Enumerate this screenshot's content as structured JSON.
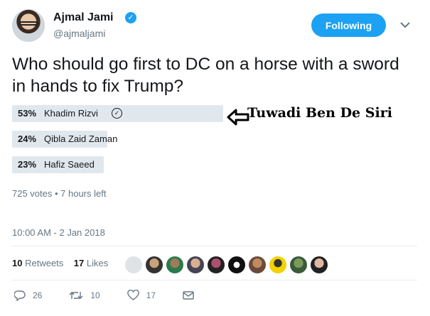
{
  "header": {
    "name": "Ajmal Jami",
    "handle": "@ajmaljami",
    "follow_label": "Following"
  },
  "tweet": {
    "text": "Who should go first to DC on a horse with a sword in hands to fix Trump?"
  },
  "poll": {
    "options": [
      {
        "pct": "53%",
        "label": "Khadim Rizvi",
        "fraction": 0.53,
        "winner": true
      },
      {
        "pct": "24%",
        "label": "Qibla Zaid Zaman",
        "fraction": 0.24,
        "winner": false
      },
      {
        "pct": "23%",
        "label": "Hafiz Saeed",
        "fraction": 0.23,
        "winner": false
      }
    ],
    "meta": "725 votes • 7 hours left",
    "annotation": "Tuwadi Ben De Siri"
  },
  "timestamp": "10:00 AM - 2 Jan 2018",
  "stats": {
    "retweets_count": "10",
    "retweets_label": "Retweets",
    "likes_count": "17",
    "likes_label": "Likes"
  },
  "actions": {
    "reply_count": "26",
    "retweet_count": "10",
    "like_count": "17"
  },
  "colors": {
    "accent": "#1da1f2",
    "poll_bar": "#e1e8ed",
    "muted": "#657786"
  }
}
